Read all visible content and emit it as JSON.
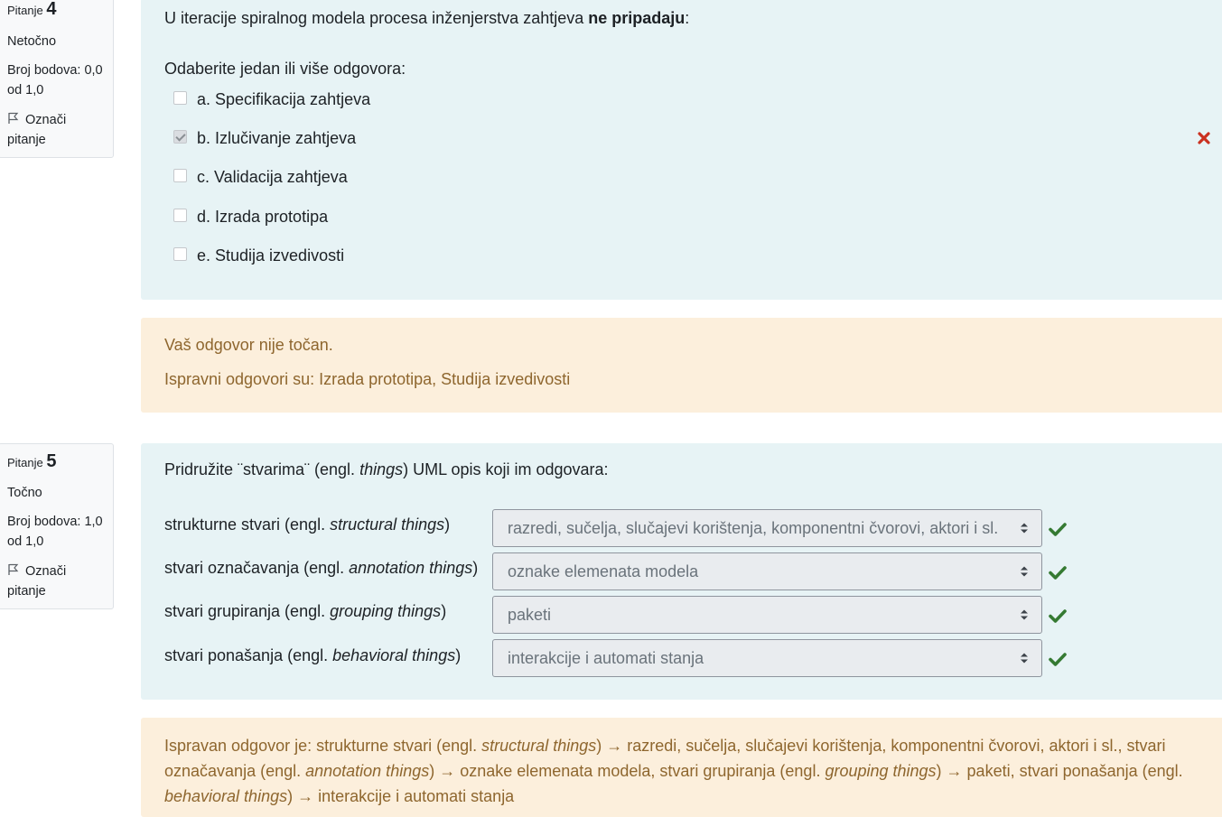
{
  "q4": {
    "info": {
      "prefix": "Pitanje",
      "number": "4",
      "state": "Netočno",
      "grade_line1": "Broj bodova: 0,0",
      "grade_line2": "od 1,0",
      "flag_line1": "Označi",
      "flag_line2": "pitanje"
    },
    "question_start": "U iteracije spiralnog modela procesa inženjerstva zahtjeva ",
    "question_bold": "ne pripadaju",
    "question_end": ":",
    "prompt": "Odaberite jedan ili više odgovora:",
    "options": [
      {
        "label": "a. Specifikacija zahtjeva",
        "checked": false
      },
      {
        "label": "b. Izlučivanje zahtjeva",
        "checked": true,
        "result": "incorrect"
      },
      {
        "label": "c. Validacija zahtjeva",
        "checked": false
      },
      {
        "label": "d. Izrada prototipa",
        "checked": false
      },
      {
        "label": "e. Studija izvedivosti",
        "checked": false
      }
    ],
    "feedback": {
      "general": "Vaš odgovor nije točan.",
      "right_answer": "Ispravni odgovori su: Izrada prototipa, Studija izvedivosti"
    }
  },
  "q5": {
    "info": {
      "prefix": "Pitanje",
      "number": "5",
      "state": "Točno",
      "grade_line1": "Broj bodova: 1,0",
      "grade_line2": "od 1,0",
      "flag_line1": "Označi",
      "flag_line2": "pitanje"
    },
    "question_pre": "Pridružite ¨stvarima¨ (engl. ",
    "question_em": "things",
    "question_post": ") UML opis koji im odgovara:",
    "rows": [
      {
        "label_pre": "strukturne stvari (engl. ",
        "label_em": "structural things",
        "label_post": ")",
        "selected": "razredi, sučelja, slučajevi korištenja, komponentni čvorovi, aktori i sl.",
        "result": "correct"
      },
      {
        "label_pre": "stvari označavanja (engl. ",
        "label_em": "annotation things",
        "label_post": ")",
        "selected": "oznake elemenata modela",
        "result": "correct"
      },
      {
        "label_pre": "stvari grupiranja (engl. ",
        "label_em": "grouping things",
        "label_post": ")",
        "selected": "paketi",
        "result": "correct"
      },
      {
        "label_pre": "stvari ponašanja (engl. ",
        "label_em": "behavioral things",
        "label_post": ")",
        "selected": "interakcije i automati stanja",
        "result": "correct"
      }
    ],
    "feedback": {
      "l1_a": "Ispravan odgovor je: strukturne stvari (engl. ",
      "l1_em": "structural things",
      "l1_b": ") → razredi, sučelja, slučajevi korištenja, komponentni čvorovi, aktori i sl., stvari",
      "l2_a": "označavanja (engl. ",
      "l2_em": "annotation things",
      "l2_b": ") → oznake elemenata modela, stvari grupiranja (engl. ",
      "l2_em2": "grouping things",
      "l2_c": ") → paketi, stvari ponašanja (engl.",
      "l3_em": "behavioral things",
      "l3_b": ") → interakcije i automati stanja"
    }
  },
  "colors": {
    "formulation_bg": "#e7f3f5",
    "feedback_bg": "#fcefdc",
    "feedback_text": "#8e662e",
    "correct": "#357a32",
    "incorrect": "#ca3120"
  },
  "icons": [
    "flag-icon",
    "cross-icon",
    "check-icon",
    "select-arrows-icon"
  ]
}
